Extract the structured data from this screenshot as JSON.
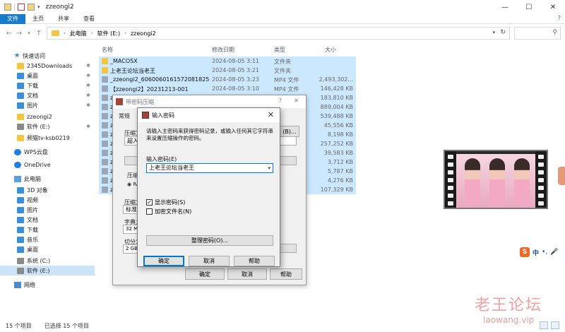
{
  "window": {
    "title": "zzeongi2",
    "controls": [
      "—",
      "☐",
      "✕"
    ]
  },
  "ribbon": {
    "tabs": [
      "文件",
      "主页",
      "共享",
      "查看"
    ],
    "help": "?"
  },
  "address": {
    "crumbs": [
      "此电脑",
      "软件 (E:)",
      "zzeongi2"
    ],
    "search_placeholder": ""
  },
  "sidebar": {
    "items": [
      {
        "label": "快速访问",
        "icon": "star-icon"
      },
      {
        "label": "2345Downloads",
        "icon": "folder-icon",
        "pinned": true
      },
      {
        "label": "桌面",
        "icon": "desktop-icon",
        "pinned": true
      },
      {
        "label": "下载",
        "icon": "download-icon",
        "pinned": true
      },
      {
        "label": "文档",
        "icon": "documents-icon",
        "pinned": true
      },
      {
        "label": "图片",
        "icon": "pictures-icon",
        "pinned": true
      },
      {
        "label": "zzeongi2",
        "icon": "folder-icon"
      },
      {
        "label": "软件 (E:)",
        "icon": "drive-icon",
        "pinned": true
      },
      {
        "label": "频猫tv-ksb0219",
        "icon": "folder-icon"
      },
      {
        "label": "WPS云盘",
        "icon": "cloud-icon"
      },
      {
        "label": "OneDrive",
        "icon": "onedrive-icon"
      },
      {
        "label": "此电脑",
        "icon": "computer-icon"
      },
      {
        "label": "3D 对象",
        "icon": "3d-objects-icon"
      },
      {
        "label": "视频",
        "icon": "videos-icon"
      },
      {
        "label": "图片",
        "icon": "pictures-icon"
      },
      {
        "label": "文档",
        "icon": "documents-icon"
      },
      {
        "label": "下载",
        "icon": "download-icon"
      },
      {
        "label": "音乐",
        "icon": "music-icon"
      },
      {
        "label": "桌面",
        "icon": "desktop-icon"
      },
      {
        "label": "系统 (C:)",
        "icon": "drive-icon"
      },
      {
        "label": "软件 (E:)",
        "icon": "drive-icon",
        "selected": true
      },
      {
        "label": "网络",
        "icon": "network-icon"
      }
    ]
  },
  "list": {
    "headers": {
      "name": "名称",
      "date": "修改日期",
      "type": "类型",
      "size": "大小"
    },
    "rows": [
      {
        "name": "_MACOSX",
        "date": "2024-08-05 3:11",
        "type": "文件夹",
        "size": "",
        "icon": "folder-icon"
      },
      {
        "name": "上老王论坛当老王",
        "date": "2024-08-05 3:21",
        "type": "文件夹",
        "size": "",
        "icon": "folder-icon"
      },
      {
        "name": "_zzeongi2_6060060161572081825",
        "date": "2024-08-05 3:23",
        "type": "MP4 文件",
        "size": "2,493,302...",
        "icon": "video-file-icon"
      },
      {
        "name": "【zzeongi2】20231213-001",
        "date": "2024-08-05 3:10",
        "type": "MP4 文件",
        "size": "146,428 KB",
        "icon": "video-file-icon"
      },
      {
        "name": "z",
        "date": "",
        "type": "",
        "size": "183,810 KB",
        "icon": "video-file-icon"
      },
      {
        "name": "z",
        "date": "",
        "type": "",
        "size": "889,004 KB",
        "icon": "video-file-icon"
      },
      {
        "name": "z",
        "date": "",
        "type": "",
        "size": "539,488 KB",
        "icon": "video-file-icon"
      },
      {
        "name": "z",
        "date": "",
        "type": "",
        "size": "45,556 KB",
        "icon": "video-file-icon"
      },
      {
        "name": "z",
        "date": "",
        "type": "",
        "size": "8,198 KB",
        "icon": "video-file-icon"
      },
      {
        "name": "z",
        "date": "",
        "type": "",
        "size": "257,252 KB",
        "icon": "video-file-icon"
      },
      {
        "name": "z",
        "date": "",
        "type": "",
        "size": "39,583 KB",
        "icon": "video-file-icon"
      },
      {
        "name": "z",
        "date": "",
        "type": "",
        "size": "3,712 KB",
        "icon": "video-file-icon"
      },
      {
        "name": "z",
        "date": "",
        "type": "",
        "size": "5,787 KB",
        "icon": "video-file-icon"
      },
      {
        "name": "z",
        "date": "",
        "type": "",
        "size": "4,276 KB",
        "icon": "video-file-icon"
      },
      {
        "name": "z",
        "date": "",
        "type": "",
        "size": "107,329 KB",
        "icon": "video-file-icon"
      }
    ]
  },
  "status": {
    "count": "15 个项目",
    "selected": "已选择 15 个项目"
  },
  "bg_dialog": {
    "title": "带密码压缩",
    "help": "?",
    "close": "✕",
    "tab_general": "常规",
    "label_compress": "压缩文",
    "label_add": "超入通",
    "label_compress2": "压缩",
    "label_compress_method": "压缩方",
    "method_value": "标准",
    "label_dict": "字典大",
    "dict_value": "32 MB",
    "label_split": "切分为",
    "split_value": "2 GB",
    "browse_label": "(B)...",
    "btn_ok": "确定",
    "btn_cancel": "取消",
    "btn_help": "帮助"
  },
  "dialog": {
    "title": "输入密码",
    "close": "✕",
    "prompt": "请输入主密码来获得密码记录，或输入任何其它字符串来设置压缩操作的密码。",
    "pwd_label": "输入密码(E)",
    "pwd_value": "上老王论坛当老王",
    "show_pwd": "显示密码(S)",
    "encrypt_names": "加密文件名(N)",
    "organize": "整理密码(O)...",
    "ok": "确定",
    "cancel": "取消",
    "help": "帮助"
  },
  "ime": {
    "mode": "中",
    "logo": "S"
  },
  "watermark": {
    "cn": "老王论坛",
    "en": "laowang.vip"
  },
  "colors": {
    "accent": "#1979ca",
    "selection": "#cce8ff",
    "watermark": "#f2a0a0"
  }
}
